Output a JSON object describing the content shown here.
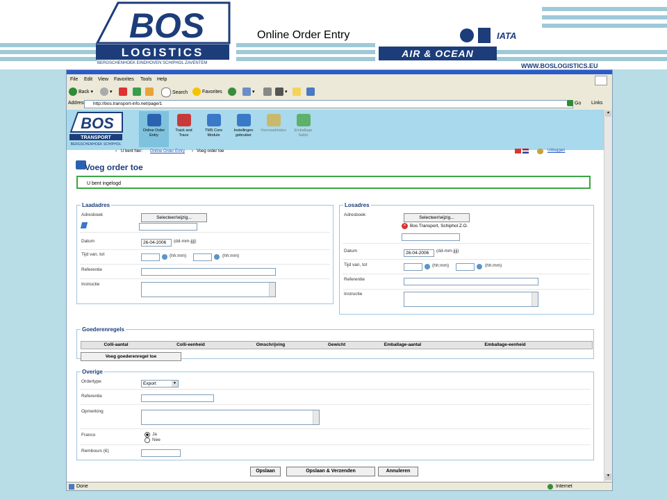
{
  "slide": {
    "title": "Online Order Entry",
    "logo_text": "BOS",
    "logo_subtext": "LOGISTICS",
    "logo_tagline": "BERGSCHENHOEK EINDHOVEN SCHIPHOL ZAVENTEM",
    "air_ocean": "AIR & OCEAN",
    "iata": "IATA",
    "website": "WWW.BOSLOGISTICS.EU"
  },
  "browser": {
    "menu": [
      "File",
      "Edit",
      "View",
      "Favorites",
      "Tools",
      "Help"
    ],
    "toolbar": {
      "back": "Back",
      "search": "Search",
      "favorites": "Favorites"
    },
    "address_label": "Address",
    "url": "http://bos.transport-info.net/page/1",
    "go": "Go",
    "links": "Links",
    "status_left": "Done",
    "status_right": "Internet"
  },
  "site": {
    "logo_text": "BOS",
    "logo_sub": "TRANSPORT",
    "logo_tag": "BERGSCHENHOEK SCHIPHOL",
    "tabs": [
      {
        "line1": "Online Order",
        "line2": "Entry"
      },
      {
        "line1": "Track and",
        "line2": "Trace"
      },
      {
        "line1": "TMS Core",
        "line2": "Module"
      },
      {
        "line1": "Instellingen",
        "line2": "gebruiker"
      },
      {
        "line1": "Voorraadstatus",
        "line2": ""
      },
      {
        "line1": "Emballage",
        "line2": "Saldo"
      }
    ],
    "breadcrumb_prefix": "U bent hier:",
    "breadcrumb_link": "Online Order Entry",
    "breadcrumb_current": "Voeg order toe",
    "logout": "Uitloggen"
  },
  "page": {
    "heading": "Voeg order toe",
    "status_message": "U bent ingelogd"
  },
  "load": {
    "legend": "Laadadres",
    "adresboek_label": "Adresboek",
    "select_button": "Selecteer/wijzig...",
    "datum_label": "Datum",
    "datum_value": "26-04-2006",
    "datum_hint": "(dd-mm-jjjj)",
    "tijd_label": "Tijd van, tot",
    "time_hint": "(hh:mm)",
    "referentie_label": "Referentie",
    "instructie_label": "Instructie"
  },
  "unload": {
    "legend": "Losadres",
    "adresboek_label": "Adresboek",
    "select_button": "Selecteer/wijzig...",
    "address_value": "Bos Transport, Schiphol Z.O.",
    "datum_label": "Datum",
    "datum_value": "26-04-2006",
    "datum_hint": "(dd-mm-jjjj)",
    "tijd_label": "Tijd van, tot",
    "time_hint": "(hh:mm)",
    "referentie_label": "Referentie",
    "instructie_label": "Instructie"
  },
  "goods": {
    "legend": "Goederenregels",
    "columns": [
      "Colli-aantal",
      "Colli-eenheid",
      "Omschrijving",
      "Gewicht",
      "Emballage-aantal",
      "Emballage-eenheid"
    ],
    "add_button": "Voeg goederenregel toe"
  },
  "other": {
    "legend": "Overige",
    "ordertype_label": "Ordertype",
    "ordertype_value": "Export",
    "referentie_label": "Referentie",
    "opmerking_label": "Opmerking",
    "franco_label": "Franco",
    "franco_options": [
      "Ja",
      "Nee"
    ],
    "rembours_label": "Rembours (€)"
  },
  "actions": {
    "save": "Opslaan",
    "save_send": "Opslaan & Verzenden",
    "cancel": "Annuleren"
  },
  "colors": {
    "brand_blue": "#1c3d7a",
    "nav_band": "#a8d9ec",
    "success_border": "#3aa543",
    "background": "#b8dde6"
  }
}
